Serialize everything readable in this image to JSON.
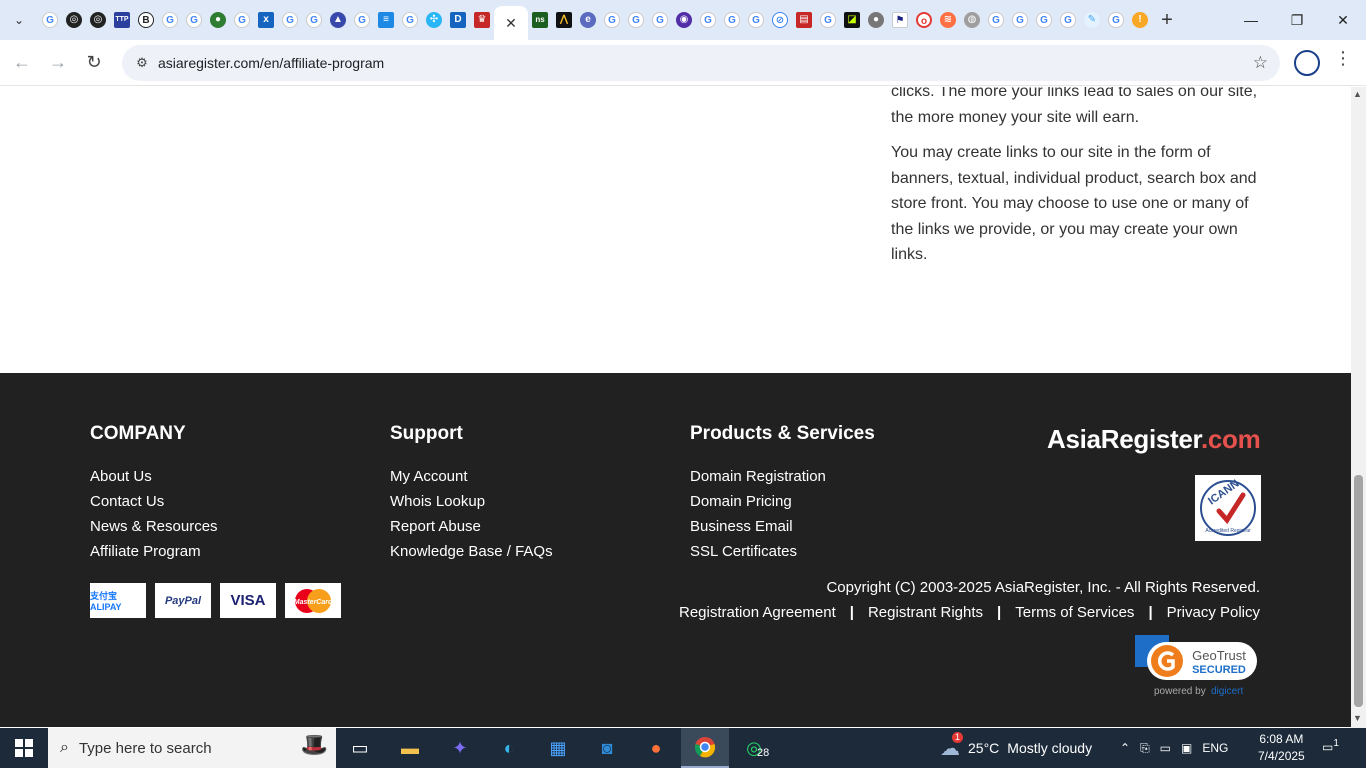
{
  "browser": {
    "active_tab_close": "✕",
    "new_tab": "+",
    "url": "asiaregister.com/en/affiliate-program"
  },
  "article": {
    "paragraphs": [
      "clicks. The more your links lead to sales on our site, the more money your site will earn.",
      "You may create links to our site in the form of banners, textual, individual product, search box and store front. You may choose to use one or many of the links we provide, or you may create your own links."
    ]
  },
  "footer": {
    "company": {
      "heading": "COMPANY",
      "links": [
        "About Us",
        "Contact Us",
        "News & Resources",
        "Affiliate Program"
      ]
    },
    "support": {
      "heading": "Support",
      "links": [
        "My Account",
        "Whois Lookup",
        "Report Abuse",
        "Knowledge Base / FAQs"
      ]
    },
    "products": {
      "heading": "Products & Services",
      "links": [
        "Domain Registration",
        "Domain Pricing",
        "Business Email",
        "SSL Certificates"
      ]
    },
    "brand_name": "AsiaRegister",
    "brand_tld": ".com",
    "icann_text": "ICANN Accredited Registrar",
    "payments": [
      "支付宝 ALIPAY",
      "PayPal",
      "VISA",
      "MasterCard"
    ],
    "copyright": "Copyright (C) 2003-2025 AsiaRegister, Inc. - All Rights Reserved.",
    "legal_links": [
      "Registration Agreement",
      "Registrant Rights",
      "Terms of Services",
      "Privacy Policy"
    ],
    "legal_sep": "|",
    "geotrust_line1": "GeoTrust",
    "geotrust_line2": "SECURED",
    "geotrust_powered": "powered by",
    "geotrust_digicert": "digicert"
  },
  "taskbar": {
    "search_placeholder": "Type here to search",
    "whatsapp_badge": "28",
    "temperature": "25°C",
    "weather_text": "Mostly cloudy",
    "weather_alert": "1",
    "language": "ENG",
    "time": "6:08 AM",
    "date": "7/4/2025",
    "notifications": "1"
  },
  "colors": {
    "footer_bg": "#212121",
    "brand_accent": "#e5524e",
    "taskbar_bg": "#1c2a3a",
    "tabstrip_bg": "#dfe9f7"
  }
}
